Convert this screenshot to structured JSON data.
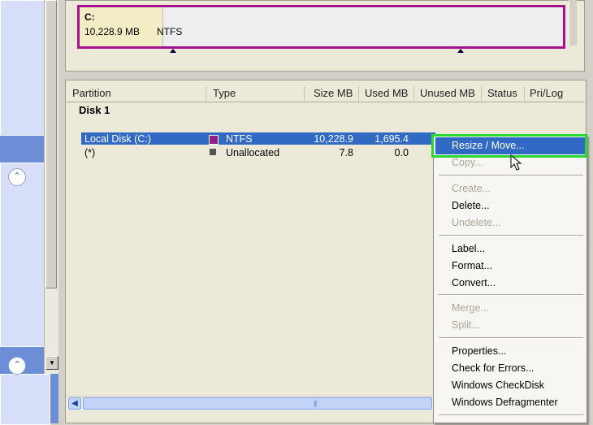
{
  "disk_map": {
    "drive": "C:",
    "size": "10,228.9 MB",
    "fs": "NTFS"
  },
  "columns": [
    "Partition",
    "Type",
    "Size MB",
    "Used MB",
    "Unused MB",
    "Status",
    "Pri/Log"
  ],
  "disk_label": "Disk 1",
  "rows": [
    {
      "partition": "Local Disk (C:)",
      "type": "NTFS",
      "size": "10,228.9",
      "used": "1,695.4",
      "selected": true
    },
    {
      "partition": "(*)",
      "type": "Unallocated",
      "size": "7.8",
      "used": "0.0",
      "selected": false
    }
  ],
  "context_menu": {
    "resize_move": "Resize / Move...",
    "copy": "Copy...",
    "create": "Create...",
    "delete": "Delete...",
    "undelete": "Undelete...",
    "label": "Label...",
    "format": "Format...",
    "convert": "Convert...",
    "merge": "Merge...",
    "split": "Split...",
    "properties": "Properties...",
    "check_errors": "Check for Errors...",
    "checkdisk": "Windows CheckDisk",
    "defragmenter": "Windows Defragmenter"
  },
  "colors": {
    "selection": "#316ac5",
    "highlight_box": "#28d82e",
    "partition_border": "#a4108e",
    "ntfs_swatch": "#8a1f86",
    "unallocated_swatch": "#555555"
  },
  "icons": {
    "collapse": "double-chevron-up-icon",
    "scroll_down": "arrow-down-icon",
    "scroll_left": "arrow-left-icon",
    "cursor": "mouse-pointer-icon"
  }
}
